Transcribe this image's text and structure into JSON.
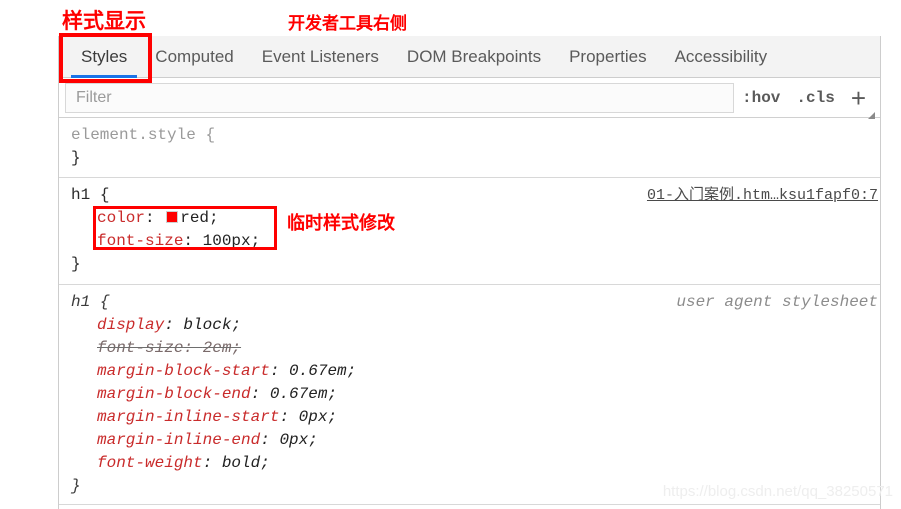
{
  "annotations": {
    "styles_display": "样式显示",
    "devtools_right": "开发者工具右侧",
    "temp_style_change": "临时样式修改"
  },
  "colors": {
    "annotation_red": "#ff0000",
    "tab_active_underline": "#1a73e8",
    "property_red": "#c92b2b",
    "swatch_red": "#ff0000",
    "panel_background": "#ffffff",
    "tabbar_background": "#f3f3f3"
  },
  "devtools": {
    "tabs": [
      {
        "label": "Styles",
        "selected": true
      },
      {
        "label": "Computed",
        "selected": false
      },
      {
        "label": "Event Listeners",
        "selected": false
      },
      {
        "label": "DOM Breakpoints",
        "selected": false
      },
      {
        "label": "Properties",
        "selected": false
      },
      {
        "label": "Accessibility",
        "selected": false
      }
    ],
    "toolbar": {
      "filter_placeholder": "Filter",
      "filter_value": "",
      "hov_label": ":hov",
      "cls_label": ".cls",
      "add_label": "+"
    },
    "rules": [
      {
        "selector": "element.style",
        "open_brace": "{",
        "close_brace": "}",
        "source": "",
        "declarations": []
      },
      {
        "selector": "h1",
        "open_brace": "{",
        "close_brace": "}",
        "source": "01-入门案例.htm…ksu1fapf0:7",
        "declarations": [
          {
            "property": "color",
            "value": "red",
            "swatch": true,
            "struck": false
          },
          {
            "property": "font-size",
            "value": "100px",
            "swatch": false,
            "struck": false
          }
        ]
      },
      {
        "selector": "h1",
        "open_brace": "{",
        "close_brace": "}",
        "source": "user agent stylesheet",
        "declarations": [
          {
            "property": "display",
            "value": "block",
            "swatch": false,
            "struck": false
          },
          {
            "property": "font-size",
            "value": "2em",
            "swatch": false,
            "struck": true
          },
          {
            "property": "margin-block-start",
            "value": "0.67em",
            "swatch": false,
            "struck": false
          },
          {
            "property": "margin-block-end",
            "value": "0.67em",
            "swatch": false,
            "struck": false
          },
          {
            "property": "margin-inline-start",
            "value": "0px",
            "swatch": false,
            "struck": false
          },
          {
            "property": "margin-inline-end",
            "value": "0px",
            "swatch": false,
            "struck": false
          },
          {
            "property": "font-weight",
            "value": "bold",
            "swatch": false,
            "struck": false
          }
        ]
      }
    ]
  },
  "watermark": "https://blog.csdn.net/qq_38250571"
}
